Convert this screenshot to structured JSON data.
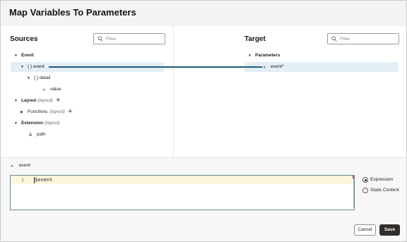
{
  "dialog": {
    "title": "Map Variables To Parameters"
  },
  "sources": {
    "title": "Sources",
    "filter_placeholder": "Filter",
    "tree": {
      "event_group": "Event",
      "event": "{ } event",
      "detail": "{ } detail",
      "value": "value",
      "layout": "Layout",
      "layout_tag": "(layout)",
      "functions": "Functions",
      "functions_tag": "(layout)",
      "extension": "Extension",
      "extension_tag": "(layout)",
      "path": "path"
    }
  },
  "target": {
    "title": "Target",
    "filter_placeholder": "Filter",
    "tree": {
      "parameters": "Parameters",
      "event": "event*"
    }
  },
  "expression": {
    "selected_label": "event",
    "line_number": "1",
    "code": "$event",
    "options": [
      {
        "label": "Expression",
        "selected": true
      },
      {
        "label": "Static Content",
        "selected": false
      }
    ]
  },
  "footer": {
    "cancel_label": "Cancel",
    "save_label": "Save"
  },
  "icons": {
    "search": "search-icon",
    "object": "object-braces-icon",
    "any_type": "asterisk-icon",
    "string_type": "letter-a-icon",
    "add": "plus-icon",
    "expand": "caret-down-icon",
    "collapse": "caret-right-icon"
  },
  "colors": {
    "selection": "#e3eef5",
    "connector": "#1d5a78",
    "primary_button": "#312d2a",
    "active_line": "#fdf6dc"
  }
}
